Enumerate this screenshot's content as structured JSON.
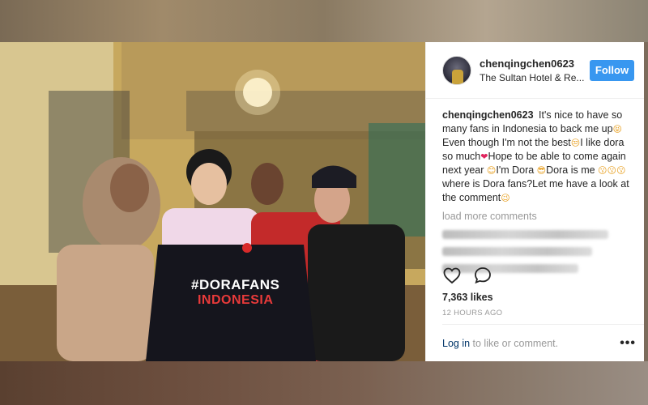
{
  "post": {
    "username": "chenqingchen0623",
    "location": "The Sultan Hotel & Re...",
    "follow_label": "Follow",
    "photo_shirt_text_1": "#DORAFANS",
    "photo_shirt_text_2": "INDONESIA",
    "caption": {
      "user": "chenqingchen0623",
      "part1": "It's nice to have so many fans in Indonesia to back me up",
      "emoji1": "😝",
      "part2": " Even though I'm not the best",
      "emoji2": "😒",
      "part3": "I like dora so much",
      "emoji3": "❤",
      "part4": "Hope to be able to come again next year ",
      "emoji4": "😊",
      "part5": "I'm Dora ",
      "emoji5": "😎",
      "part6": "Dora is me ",
      "emoji6": "😗😗😗",
      "part7": "where is Dora fans?Let me have a look at the comment",
      "emoji7": "😉"
    },
    "load_more": "load more comments",
    "likes": "7,363 likes",
    "time": "12 HOURS AGO",
    "login_link": "Log in",
    "login_suffix": " to like or comment.",
    "more_label": "•••",
    "icons": [
      "heart-icon",
      "comment-icon",
      "more-options-icon"
    ],
    "colors": {
      "follow": "#3897f0",
      "text": "#262626",
      "muted": "#999999"
    }
  }
}
